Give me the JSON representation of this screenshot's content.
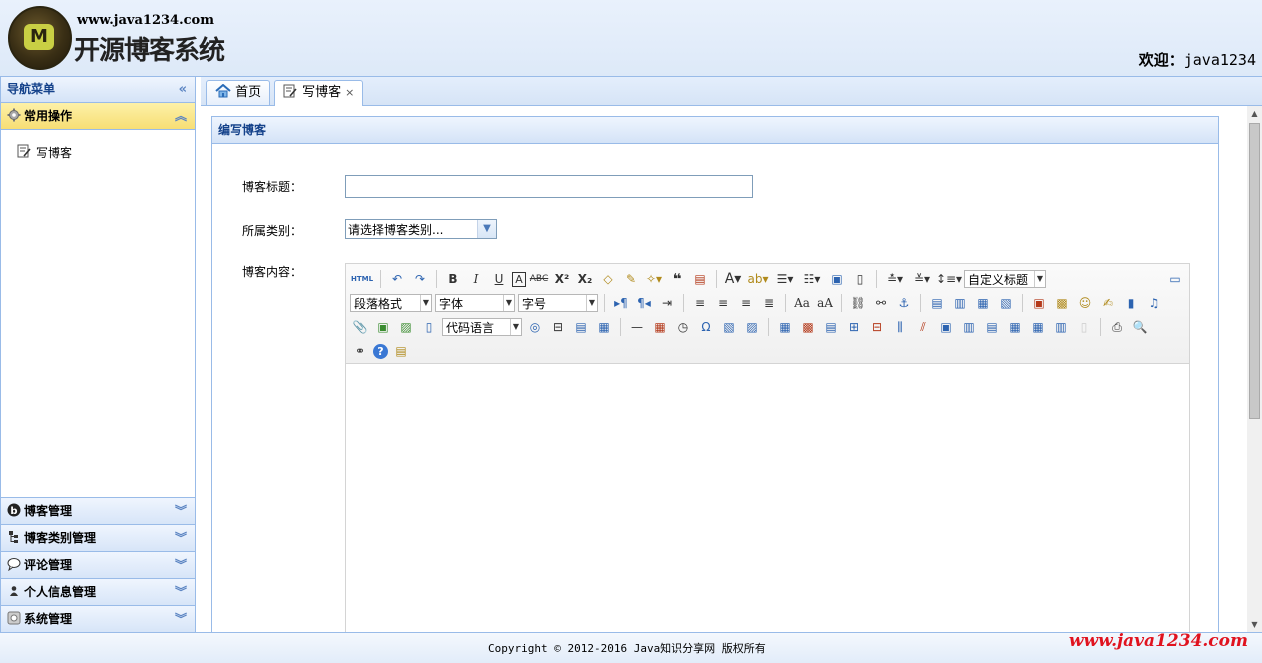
{
  "header": {
    "site_url": "www.java1234.com",
    "site_title": "开源博客系统",
    "logo_letter": "M",
    "welcome_label": "欢迎：",
    "username": "java1234"
  },
  "sidebar": {
    "title": "导航菜单",
    "sections": [
      {
        "label": "常用操作",
        "items": [
          "写博客"
        ]
      },
      {
        "label": "博客管理"
      },
      {
        "label": "博客类别管理"
      },
      {
        "label": "评论管理"
      },
      {
        "label": "个人信息管理"
      },
      {
        "label": "系统管理"
      }
    ]
  },
  "tabs": [
    {
      "label": "首页"
    },
    {
      "label": "写博客",
      "close": "×"
    }
  ],
  "form": {
    "panel_title": "编写博客",
    "title_label": "博客标题：",
    "title_value": "",
    "category_label": "所属类别：",
    "category_value": "请选择博客类别...",
    "content_label": "博客内容："
  },
  "editor": {
    "html_label": "HTML",
    "custom_heading": "自定义标题",
    "paragraph_format": "段落格式",
    "font_family": "字体",
    "font_size": "字号",
    "code_language": "代码语言"
  },
  "footer": {
    "copyright": "Copyright © 2012-2016 Java知识分享网 版权所有",
    "watermark": "www.java1234.com"
  },
  "colors": {
    "border": "#99bbe8",
    "header_text": "#15428b",
    "active_section": "#f7de74",
    "watermark": "#e0121e"
  }
}
